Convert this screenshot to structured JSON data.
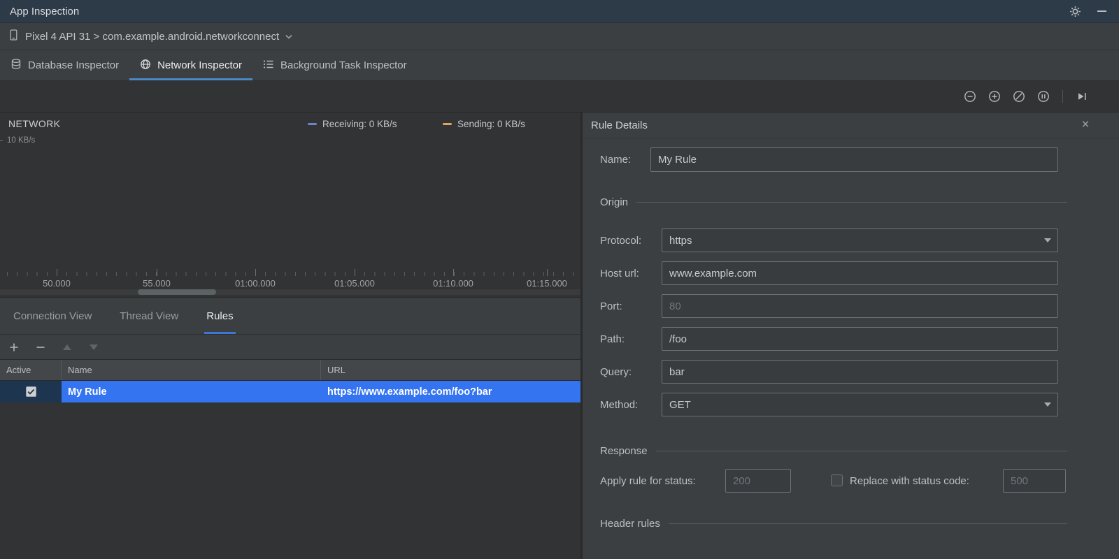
{
  "window": {
    "title": "App Inspection"
  },
  "device_bar": {
    "selector": "Pixel 4 API 31 > com.example.android.networkconnect"
  },
  "inspector_tabs": [
    {
      "label": "Database Inspector"
    },
    {
      "label": "Network Inspector"
    },
    {
      "label": "Background Task Inspector"
    }
  ],
  "timeline": {
    "title": "NETWORK",
    "y_axis_label": "10 KB/s",
    "legend": [
      {
        "label": "Receiving: 0 KB/s",
        "color": "#6E84C8"
      },
      {
        "label": "Sending: 0 KB/s",
        "color": "#DFA560"
      }
    ],
    "ticks": [
      "50.000",
      "55.000",
      "01:00.000",
      "01:05.000",
      "01:10.000",
      "01:15.000"
    ]
  },
  "view_tabs": [
    {
      "label": "Connection View"
    },
    {
      "label": "Thread View"
    },
    {
      "label": "Rules"
    }
  ],
  "rules_table": {
    "columns": [
      "Active",
      "Name",
      "URL"
    ],
    "rows": [
      {
        "active": true,
        "name": "My Rule",
        "url": "https://www.example.com/foo?bar"
      }
    ]
  },
  "rule_details": {
    "title": "Rule Details",
    "name_label": "Name:",
    "name_value": "My Rule",
    "origin_section": "Origin",
    "protocol_label": "Protocol:",
    "protocol_value": "https",
    "host_label": "Host url:",
    "host_value": "www.example.com",
    "port_label": "Port:",
    "port_placeholder": "80",
    "path_label": "Path:",
    "path_value": "/foo",
    "query_label": "Query:",
    "query_value": "bar",
    "method_label": "Method:",
    "method_value": "GET",
    "response_section": "Response",
    "apply_status_label": "Apply rule for status:",
    "apply_status_placeholder": "200",
    "replace_label": "Replace with status code:",
    "replace_placeholder": "500",
    "header_rules_section": "Header rules"
  },
  "colors": {
    "selection_blue": "#3574F0",
    "tab_underline": "#4A88C7",
    "receiving_series": "#6E84C8",
    "sending_series": "#DFA560"
  }
}
